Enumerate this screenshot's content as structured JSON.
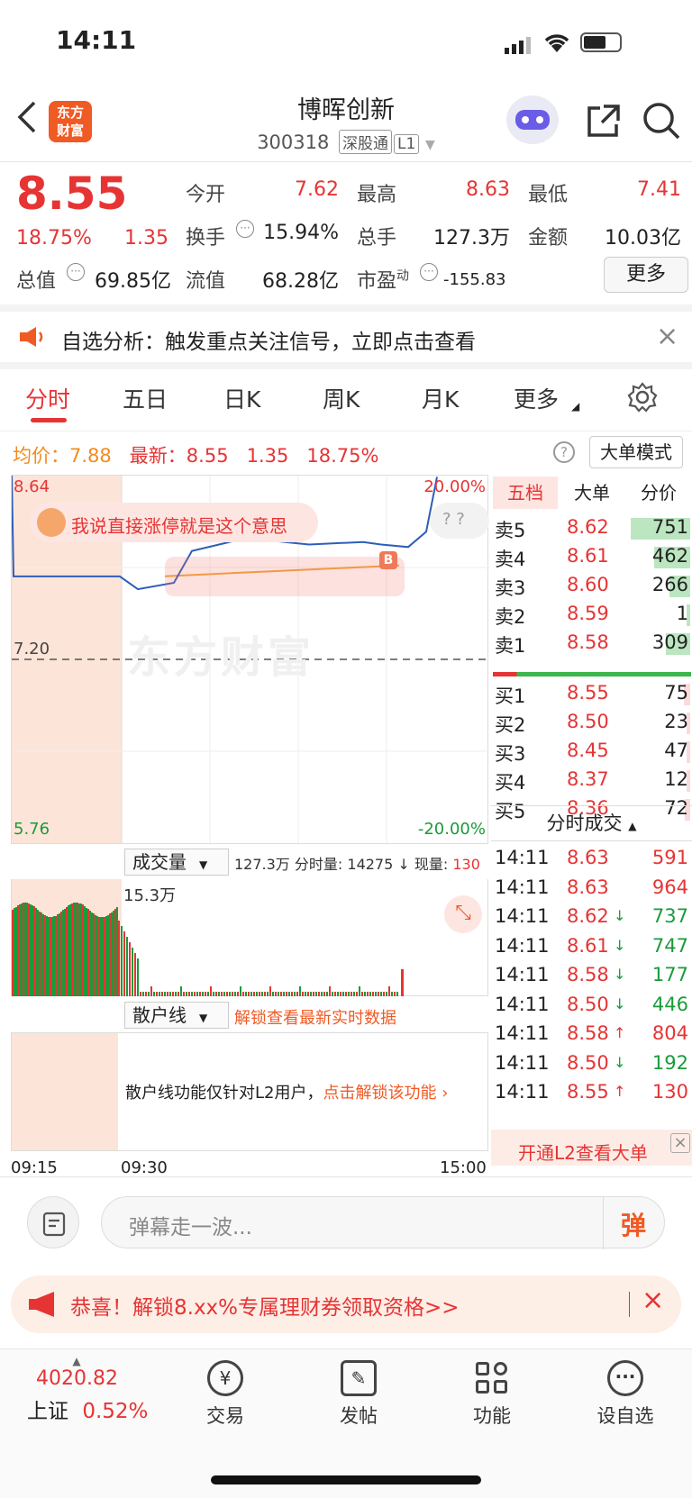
{
  "status": {
    "time": "14:11"
  },
  "header": {
    "logo": "东方\n财富",
    "stock_name": "博晖创新",
    "stock_code": "300318",
    "tag1": "深股通",
    "tag2": "L1"
  },
  "quote": {
    "price": "8.55",
    "change_pct": "18.75%",
    "change": "1.35",
    "open_label": "今开",
    "open": "7.62",
    "high_label": "最高",
    "high": "8.63",
    "low_label": "最低",
    "low": "7.41",
    "turnover_label": "换手",
    "turnover": "15.94%",
    "volume_label": "总手",
    "volume": "127.3万",
    "amount_label": "金额",
    "amount": "10.03亿",
    "mktcap_label": "总值",
    "mktcap": "69.85亿",
    "float_label": "流值",
    "float": "68.28亿",
    "pe_label": "市盈",
    "pe_sup": "动",
    "pe": "-155.83",
    "more": "更多"
  },
  "alert": {
    "text": "自选分析：触发重点关注信号，立即点击查看"
  },
  "tabs": [
    "分时",
    "五日",
    "日K",
    "周K",
    "月K",
    "更多"
  ],
  "chart_info": {
    "avg_label": "均价：",
    "avg": "7.88",
    "latest_label": "最新：",
    "latest": "8.55",
    "change": "1.35",
    "change_pct": "18.75%",
    "mode_button": "大单模式"
  },
  "chart": {
    "ytop": "8.64",
    "ymid": "7.20",
    "ybot": "5.76",
    "pct_top": "20.00%",
    "pct_bot": "-20.00%",
    "tip": "我说直接涨停就是这个意思",
    "watermark": "东方财富",
    "b_marker": "B",
    "volume_label": "成交量",
    "volume_info1": "127.3万",
    "volume_info2": "分时量: 14275",
    "volume_info3": "现量:",
    "volume_now": "130",
    "volume_max": "15.3万",
    "retail_label": "散户线",
    "retail_unlock": "解锁查看最新实时数据",
    "retail_text": "散户线功能仅针对L2用户，",
    "retail_link": "点击解锁该功能",
    "t_start": "09:15",
    "t_mid": "09:30",
    "t_end": "15:00"
  },
  "chart_data": {
    "type": "line",
    "ylim": [
      5.76,
      8.64
    ],
    "x": [
      "09:15",
      "09:25",
      "09:30",
      "09:35",
      "09:45",
      "10:00",
      "10:30",
      "11:00",
      "11:30",
      "13:30",
      "14:00",
      "14:10",
      "14:11"
    ],
    "series": [
      {
        "values": [
          8.64,
          7.85,
          7.85,
          7.75,
          7.8,
          8.05,
          8.15,
          8.1,
          8.12,
          8.1,
          8.08,
          8.2,
          8.63
        ]
      }
    ]
  },
  "orderbook": {
    "tabs": [
      "五档",
      "大单",
      "分价"
    ],
    "asks": [
      {
        "label": "卖5",
        "price": "8.62",
        "vol": "751"
      },
      {
        "label": "卖4",
        "price": "8.61",
        "vol": "462"
      },
      {
        "label": "卖3",
        "price": "8.60",
        "vol": "266"
      },
      {
        "label": "卖2",
        "price": "8.59",
        "vol": "1"
      },
      {
        "label": "卖1",
        "price": "8.58",
        "vol": "309"
      }
    ],
    "bids": [
      {
        "label": "买1",
        "price": "8.55",
        "vol": "75"
      },
      {
        "label": "买2",
        "price": "8.50",
        "vol": "23"
      },
      {
        "label": "买3",
        "price": "8.45",
        "vol": "47"
      },
      {
        "label": "买4",
        "price": "8.37",
        "vol": "12"
      },
      {
        "label": "买5",
        "price": "8.36",
        "vol": "72"
      }
    ],
    "trades_title": "分时成交",
    "trades": [
      {
        "t": "14:11",
        "p": "8.63",
        "v": "591",
        "d": ""
      },
      {
        "t": "14:11",
        "p": "8.63",
        "v": "964",
        "d": ""
      },
      {
        "t": "14:11",
        "p": "8.62",
        "v": "737",
        "d": "↓"
      },
      {
        "t": "14:11",
        "p": "8.61",
        "v": "747",
        "d": "↓"
      },
      {
        "t": "14:11",
        "p": "8.58",
        "v": "177",
        "d": "↓"
      },
      {
        "t": "14:11",
        "p": "8.50",
        "v": "446",
        "d": "↓"
      },
      {
        "t": "14:11",
        "p": "8.58",
        "v": "804",
        "d": "↑"
      },
      {
        "t": "14:11",
        "p": "8.50",
        "v": "192",
        "d": "↓"
      },
      {
        "t": "14:11",
        "p": "8.55",
        "v": "130",
        "d": "↑"
      }
    ],
    "l2_link": "开通L2查看大单"
  },
  "comment": {
    "placeholder": "弹幕走一波...",
    "danmu": "弹"
  },
  "promo": {
    "text": "恭喜！解锁8.xx%专属理财券领取资格>>"
  },
  "nav": {
    "index_value": "4020.82",
    "index_name": "上证",
    "index_pct": "0.52%",
    "items": [
      "交易",
      "发帖",
      "功能",
      "设自选"
    ]
  }
}
